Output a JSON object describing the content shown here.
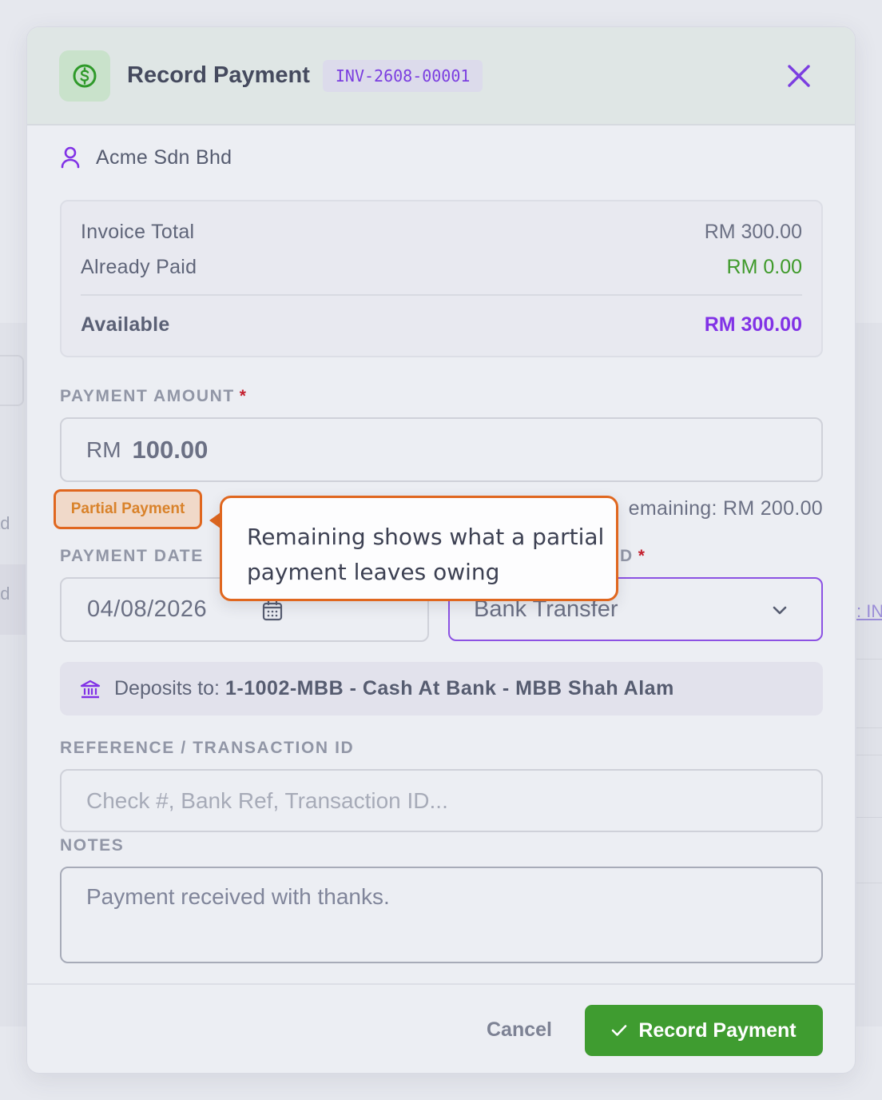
{
  "background": {
    "left_items": [
      "ad",
      "ad"
    ],
    "right_link": ": IN"
  },
  "modal": {
    "title": "Record Payment",
    "invoice_number": "INV-2608-00001",
    "customer": "Acme Sdn Bhd",
    "summary": {
      "invoice_total_label": "Invoice Total",
      "invoice_total_value": "RM 300.00",
      "already_paid_label": "Already Paid",
      "already_paid_value": "RM 0.00",
      "available_label": "Available",
      "available_value": "RM 300.00"
    },
    "payment_amount": {
      "label": "PAYMENT AMOUNT",
      "required_mark": "*",
      "currency": "RM",
      "value": "100.00"
    },
    "partial_badge": "Partial Payment",
    "remaining": "emaining: RM 200.00",
    "payment_date": {
      "label": "PAYMENT DATE",
      "value": "04/08/2026"
    },
    "payment_method": {
      "label_tail": "D",
      "required_mark": "*",
      "value": "Bank Transfer"
    },
    "deposit": {
      "label": "Deposits to:",
      "account": "1-1002-MBB - Cash At Bank - MBB Shah Alam"
    },
    "reference": {
      "label": "REFERENCE / TRANSACTION ID",
      "placeholder": "Check #, Bank Ref, Transaction ID..."
    },
    "notes": {
      "label": "NOTES",
      "value": "Payment received with thanks."
    },
    "footer": {
      "cancel_label": "Cancel",
      "submit_label": "Record Payment"
    }
  },
  "tooltip": {
    "text": "Remaining shows what a partial payment leaves owing"
  },
  "colors": {
    "accent_purple": "#8132e6",
    "success_green": "#3f9c30",
    "callout_orange": "#e0671f"
  },
  "icons": [
    "dollar-circle-icon",
    "close-icon",
    "user-icon",
    "calendar-icon",
    "chevron-down-icon",
    "bank-icon",
    "check-icon"
  ]
}
